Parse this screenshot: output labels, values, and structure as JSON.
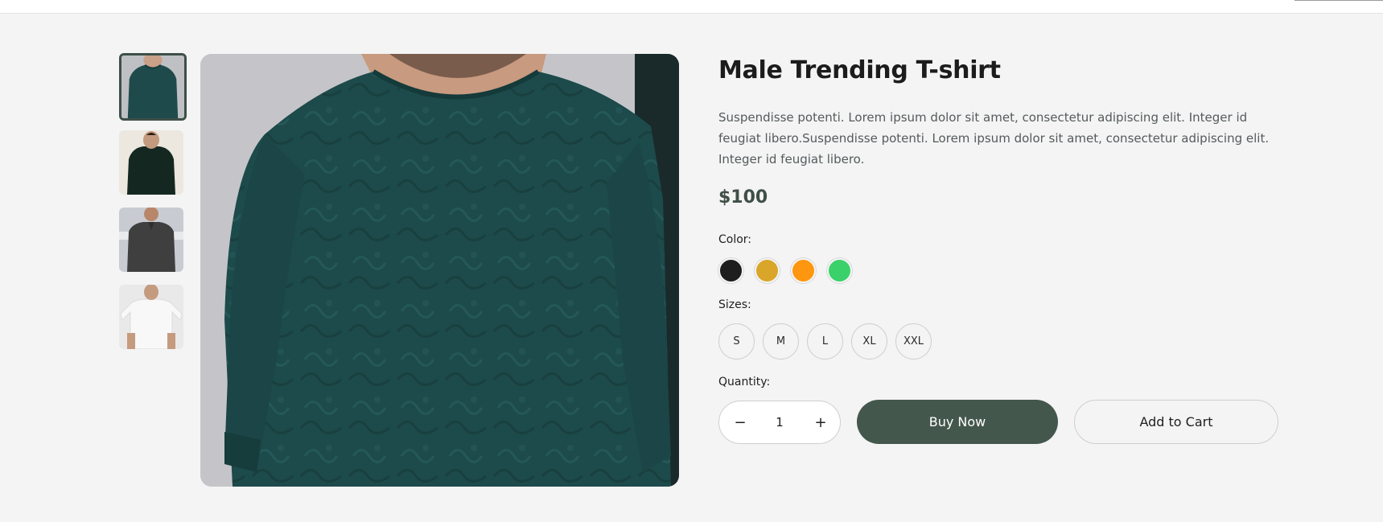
{
  "product": {
    "title": "Male Trending T-shirt",
    "description": "Suspendisse potenti. Lorem ipsum dolor sit amet, consectetur adipiscing elit. Integer id feugiat libero.Suspendisse potenti. Lorem ipsum dolor sit amet, consectetur adipiscing elit. Integer id feugiat libero.",
    "price": "$100"
  },
  "color": {
    "label": "Color:",
    "options": [
      {
        "name": "black",
        "hex": "#1e1e1e"
      },
      {
        "name": "goldenrod",
        "hex": "#d9a62a"
      },
      {
        "name": "orange",
        "hex": "#ff960f"
      },
      {
        "name": "green",
        "hex": "#3ad16b"
      }
    ]
  },
  "sizes": {
    "label": "Sizes:",
    "options": [
      "S",
      "M",
      "L",
      "XL",
      "XXL"
    ]
  },
  "quantity": {
    "label": "Quantity:",
    "decrement": "−",
    "value": "1",
    "increment": "+"
  },
  "actions": {
    "buy_now": "Buy Now",
    "add_to_cart": "Add to Cart"
  },
  "colors": {
    "page_bg": "#f4f4f4",
    "primary": "#44574c",
    "shirt_teal": "#1d4a4b"
  }
}
